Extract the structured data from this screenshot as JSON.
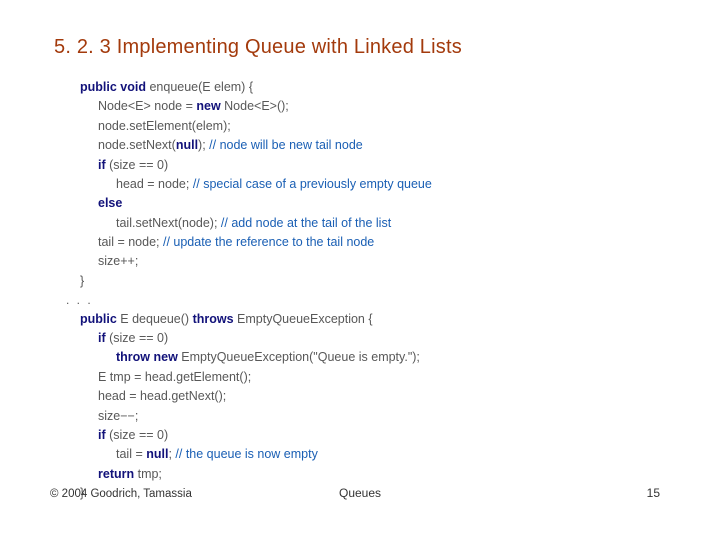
{
  "title": "5. 2. 3 Implementing Queue with Linked Lists",
  "code": {
    "l1a": "public void",
    "l1b": " enqueue(E elem) {",
    "l2": "Node<E> node = ",
    "l2kw": "new",
    "l2b": " Node<E>();",
    "l3": "node.setElement(elem);",
    "l4": "node.setNext(",
    "l4kw": "null",
    "l4b": "); ",
    "l4c": "// node will be new tail node",
    "l5kw": "if",
    "l5": " (size == 0)",
    "l6": "head = node; ",
    "l6c": "// special case of a previously empty queue",
    "l7kw": "else",
    "l8": "tail.setNext(node); ",
    "l8c": "// add node at the tail of the list",
    "l9": "tail = node; ",
    "l9c": "// update the reference to the tail node",
    "l10": "size++;",
    "l11": "}",
    "dots": ". . .",
    "d1a": "public",
    "d1b": " E dequeue() ",
    "d1c": "throws",
    "d1d": " EmptyQueueException {",
    "d2kw": "if",
    "d2": " (size == 0)",
    "d3a": "throw new",
    "d3b": " EmptyQueueException(\"Queue is empty.\");",
    "d4": "E tmp = head.getElement();",
    "d5": "head = head.getNext();",
    "d6": "size−−;",
    "d7kw": "if",
    "d7": " (size == 0)",
    "d8": "tail = ",
    "d8kw": "null",
    "d8b": "; ",
    "d8c": "// the queue is now empty",
    "d9kw": "return",
    "d9": " tmp;",
    "d10": "}"
  },
  "footer": {
    "left": "© 2004 Goodrich, Tamassia",
    "center": "Queues",
    "right": "15"
  }
}
